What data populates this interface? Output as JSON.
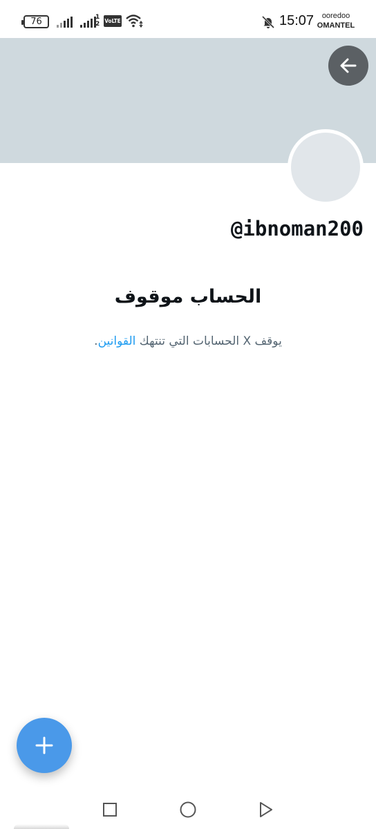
{
  "status_bar": {
    "battery": "76",
    "sim_digits_top": "1",
    "sim_digits_bottom": "2",
    "volte": "VoLTE",
    "time": "15:07",
    "carrier_line1": "ooredoo",
    "carrier_line2": "OMANTEL",
    "icons": [
      "signal-icon",
      "signal-icon",
      "volte-icon",
      "wifi-icon",
      "bell-off-icon"
    ]
  },
  "profile": {
    "handle": "@ibnoman200",
    "banner_color": "#cfd9de",
    "avatar_color": "#e1e6ea"
  },
  "suspension": {
    "title": "الحساب موقوف",
    "desc_prefix": "يوقف X الحسابات التي تنتهك ",
    "rules_link": "القوانين",
    "desc_suffix": "."
  },
  "colors": {
    "accent": "#1d9bf0",
    "fab": "#4a99e9",
    "back_button": "#5b6064"
  },
  "fab": {
    "icon": "plus-icon"
  },
  "nav": {
    "icons": [
      "square-icon",
      "circle-icon",
      "triangle-icon"
    ]
  }
}
